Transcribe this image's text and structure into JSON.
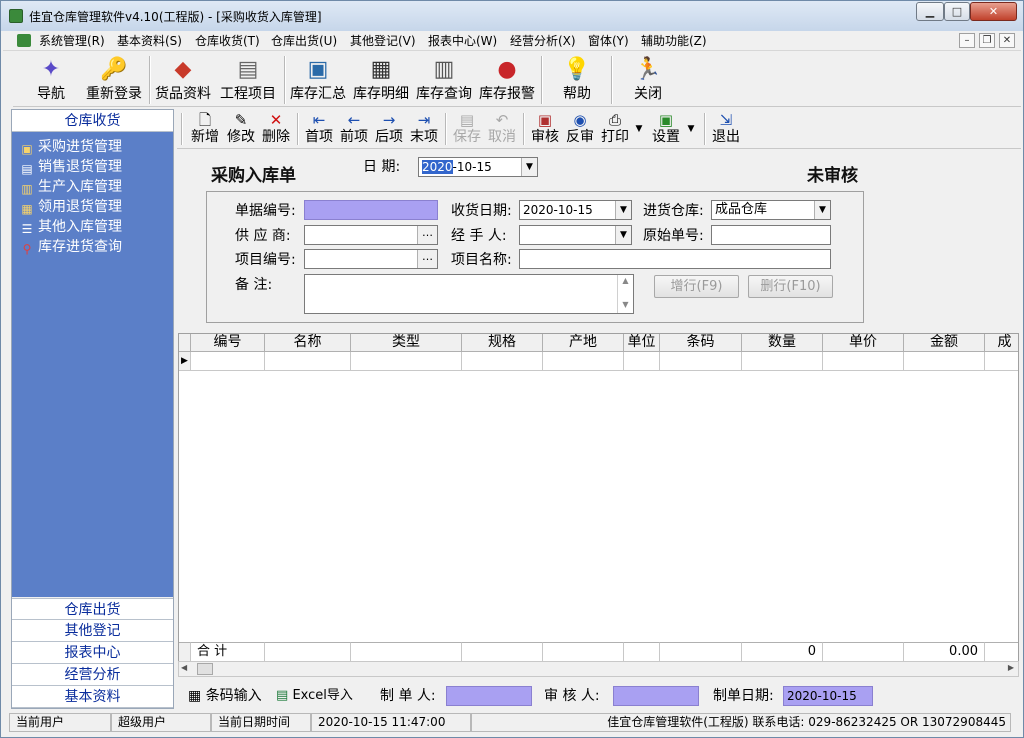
{
  "window": {
    "title": "佳宜仓库管理软件v4.10(工程版)  - [采购收货入库管理]"
  },
  "menubar": {
    "items": [
      "系统管理(R)",
      "基本资料(S)",
      "仓库收货(T)",
      "仓库出货(U)",
      "其他登记(V)",
      "报表中心(W)",
      "经营分析(X)",
      "窗体(Y)",
      "辅助功能(Z)"
    ]
  },
  "toolbar": {
    "items": [
      {
        "label": "导航",
        "icon": "navigate-icon"
      },
      {
        "label": "重新登录",
        "icon": "relogin-icon"
      },
      {
        "label": "货品资料",
        "icon": "goods-icon"
      },
      {
        "label": "工程项目",
        "icon": "project-icon"
      },
      {
        "label": "库存汇总",
        "icon": "inventory-summary-icon"
      },
      {
        "label": "库存明细",
        "icon": "inventory-detail-icon"
      },
      {
        "label": "库存查询",
        "icon": "inventory-query-icon"
      },
      {
        "label": "库存报警",
        "icon": "traffic-light-icon"
      },
      {
        "label": "帮助",
        "icon": "lightbulb-icon"
      },
      {
        "label": "关闭",
        "icon": "running-man-icon"
      }
    ]
  },
  "sidebar": {
    "top_section": "仓库收货",
    "items": [
      "采购进货管理",
      "销售退货管理",
      "生产入库管理",
      "领用退货管理",
      "其他入库管理",
      "库存进货查询"
    ],
    "bottom_sections": [
      "仓库出货",
      "其他登记",
      "报表中心",
      "经营分析",
      "基本资料"
    ]
  },
  "subtoolbar": {
    "items": [
      {
        "label": "新增",
        "icon": "new-doc-icon",
        "enabled": true
      },
      {
        "label": "修改",
        "icon": "edit-icon",
        "enabled": true
      },
      {
        "label": "删除",
        "icon": "delete-icon",
        "enabled": true
      },
      {
        "label": "首项",
        "icon": "first-arrow-icon",
        "enabled": true
      },
      {
        "label": "前项",
        "icon": "prev-arrow-icon",
        "enabled": true
      },
      {
        "label": "后项",
        "icon": "next-arrow-icon",
        "enabled": true
      },
      {
        "label": "末项",
        "icon": "last-arrow-icon",
        "enabled": true
      },
      {
        "label": "保存",
        "icon": "save-icon",
        "enabled": false
      },
      {
        "label": "取消",
        "icon": "undo-icon",
        "enabled": false
      },
      {
        "label": "审核",
        "icon": "approve-icon",
        "enabled": true
      },
      {
        "label": "反审",
        "icon": "unapprove-icon",
        "enabled": true
      },
      {
        "label": "打印",
        "icon": "printer-icon",
        "enabled": true
      },
      {
        "label": "设置",
        "icon": "settings-icon",
        "enabled": true
      },
      {
        "label": "退出",
        "icon": "exit-icon",
        "enabled": true
      }
    ]
  },
  "form": {
    "title": "采购入库单",
    "date_label": "日  期:",
    "date_year": "2020",
    "date_rest": "-10-15",
    "status": "未审核",
    "doc_no_label": "单据编号:",
    "doc_no_value": "",
    "receive_date_label": "收货日期:",
    "receive_date_value": "2020-10-15",
    "warehouse_label": "进货仓库:",
    "warehouse_value": "成品仓库",
    "supplier_label": "供 应 商:",
    "supplier_value": "",
    "handler_label": "经 手 人:",
    "handler_value": "",
    "orig_no_label": "原始单号:",
    "orig_no_value": "",
    "project_no_label": "项目编号:",
    "project_no_value": "",
    "project_name_label": "项目名称:",
    "project_name_value": "",
    "remark_label": "备   注:",
    "remark_value": "",
    "add_row_button": "增行(F9)",
    "del_row_button": "删行(F10)"
  },
  "grid": {
    "columns": [
      "编号",
      "名称",
      "类型",
      "规格",
      "产地",
      "单位",
      "条码",
      "数量",
      "单价",
      "金额",
      "成"
    ],
    "footer_label": "合  计",
    "footer_qty": "0",
    "footer_amount": "0.00"
  },
  "bottom": {
    "barcode_button": "条码输入",
    "excel_button": "Excel导入",
    "maker_label": "制 单 人:",
    "maker_value": "",
    "reviewer_label": "审 核 人:",
    "reviewer_value": "",
    "made_date_label": "制单日期:",
    "made_date_value": "2020-10-15"
  },
  "statusbar": {
    "user_label": "当前用户",
    "user_value": "超级用户",
    "datetime_label": "当前日期时间",
    "datetime_value": "2020-10-15 11:47:00",
    "info": "佳宜仓库管理软件(工程版) 联系电话: 029-86232425 OR 13072908445"
  }
}
